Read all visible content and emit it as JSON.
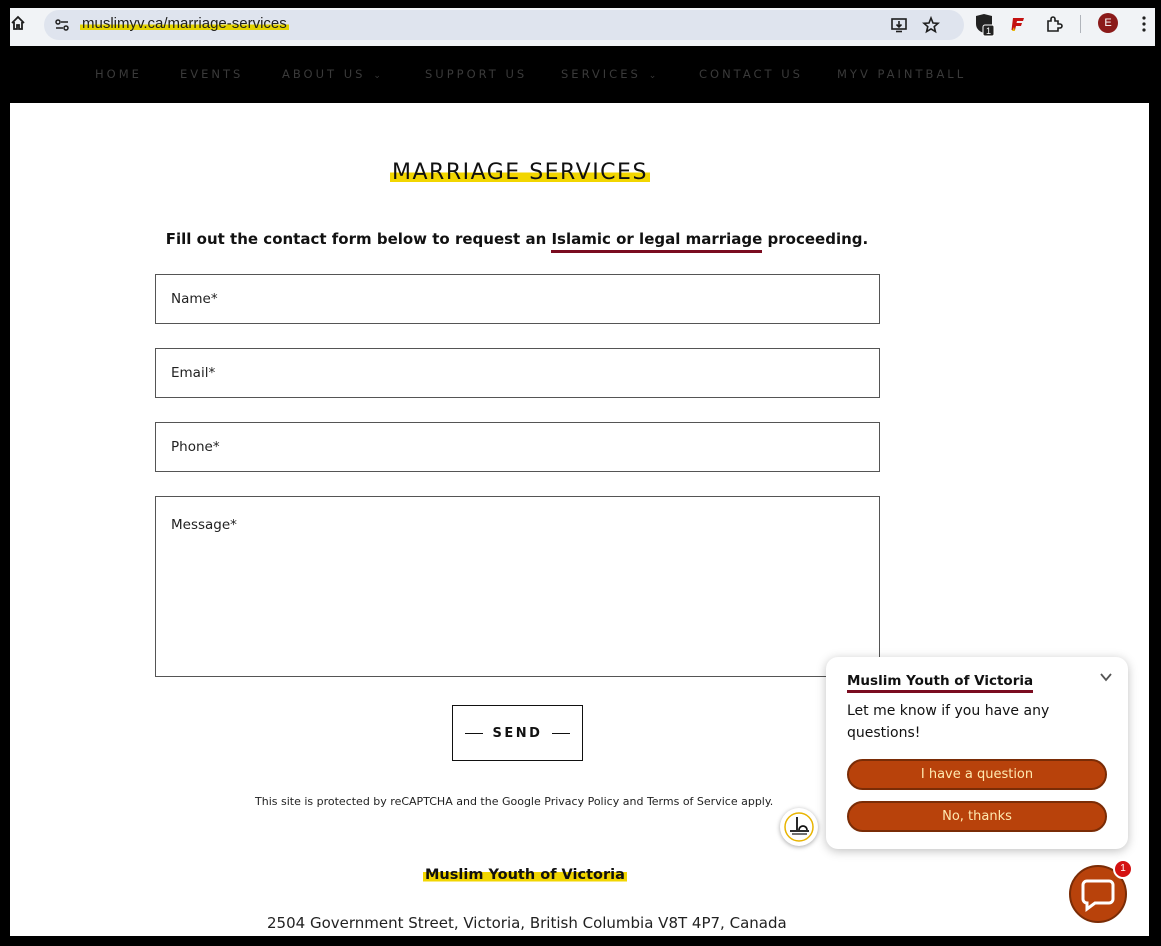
{
  "browser": {
    "url": "muslimyv.ca/marriage-services",
    "extension_badge_count": "1",
    "profile_initial": "E"
  },
  "nav": {
    "items": [
      {
        "label": "HOME"
      },
      {
        "label": "EVENTS"
      },
      {
        "label": "ABOUT US",
        "has_dropdown": true
      },
      {
        "label": "SUPPORT US"
      },
      {
        "label": "SERVICES",
        "has_dropdown": true
      },
      {
        "label": "CONTACT US"
      },
      {
        "label": "MYV PAINTBALL"
      }
    ]
  },
  "main": {
    "title": "MARRIAGE SERVICES",
    "intro_before": "Fill out the contact form below to request an ",
    "intro_highlight": "Islamic or legal marriage",
    "intro_after": " proceeding.",
    "form": {
      "name_placeholder": "Name*",
      "email_placeholder": "Email*",
      "phone_placeholder": "Phone*",
      "message_placeholder": "Message*",
      "send_label": "SEND"
    },
    "recaptcha": {
      "before": "This site is protected by reCAPTCHA and the Google ",
      "privacy": "Privacy Policy",
      "and": " and ",
      "terms": "Terms of Service",
      "after": " apply."
    }
  },
  "footer": {
    "org_name": "Muslim Youth of Victoria",
    "address": "2504 Government Street, Victoria, British Columbia V8T 4P7, Canada"
  },
  "chat": {
    "org_name": "Muslim Youth of Victoria",
    "message": "Let me know if you have any questions!",
    "question_button": "I have a question",
    "decline_button": "No, thanks",
    "unread_count": "1"
  },
  "colors": {
    "highlight_yellow": "#f2d600",
    "accent_maroon": "#7a0c20",
    "chat_orange": "#b8420b"
  }
}
